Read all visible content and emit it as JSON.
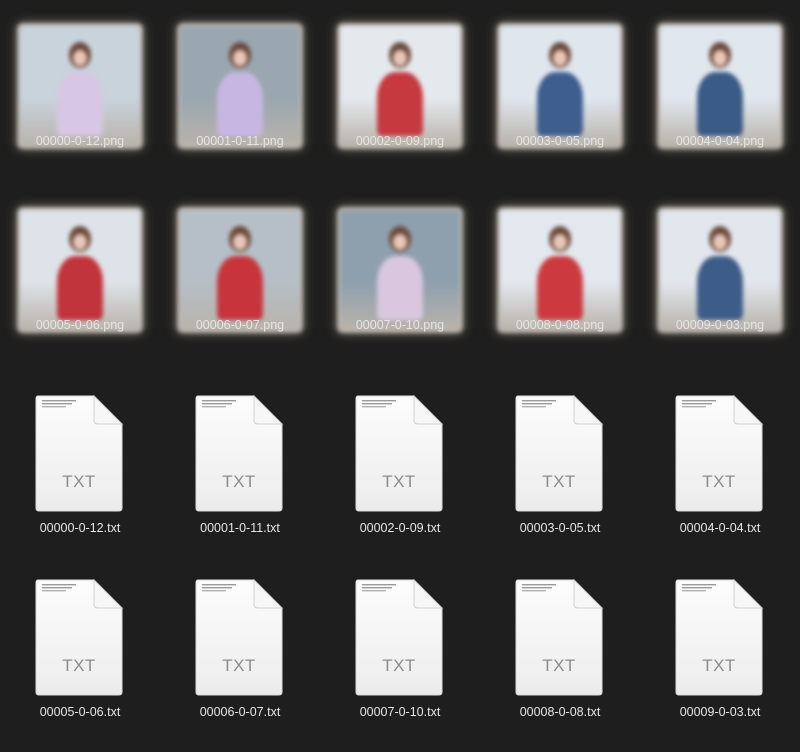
{
  "window": {
    "background": "#1e1e1e"
  },
  "files": {
    "png_row1": [
      {
        "name": "00000-0-12.png",
        "bg": "#c8d3dc",
        "outfit": "#d7c6e4"
      },
      {
        "name": "00001-0-11.png",
        "bg": "#9aa7b0",
        "outfit": "#c7b6e2"
      },
      {
        "name": "00002-0-09.png",
        "bg": "#e4e9ee",
        "outfit": "#c63a3f"
      },
      {
        "name": "00003-0-05.png",
        "bg": "#dfe6ee",
        "outfit": "#3d5e8f"
      },
      {
        "name": "00004-0-04.png",
        "bg": "#e1e7ef",
        "outfit": "#3a5b86"
      }
    ],
    "png_row2": [
      {
        "name": "00005-0-06.png",
        "bg": "#dde3e8",
        "outfit": "#c2343b"
      },
      {
        "name": "00006-0-07.png",
        "bg": "#b6bfc7",
        "outfit": "#c7343c"
      },
      {
        "name": "00007-0-10.png",
        "bg": "#8ea0ad",
        "outfit": "#d8c7df"
      },
      {
        "name": "00008-0-08.png",
        "bg": "#e3e8ef",
        "outfit": "#cc3a3f"
      },
      {
        "name": "00009-0-03.png",
        "bg": "#e2e7ee",
        "outfit": "#3d5c88"
      }
    ],
    "txt_row1": [
      {
        "name": "00000-0-12.txt",
        "kind": "TXT"
      },
      {
        "name": "00001-0-11.txt",
        "kind": "TXT"
      },
      {
        "name": "00002-0-09.txt",
        "kind": "TXT"
      },
      {
        "name": "00003-0-05.txt",
        "kind": "TXT"
      },
      {
        "name": "00004-0-04.txt",
        "kind": "TXT"
      }
    ],
    "txt_row2": [
      {
        "name": "00005-0-06.txt",
        "kind": "TXT"
      },
      {
        "name": "00006-0-07.txt",
        "kind": "TXT"
      },
      {
        "name": "00007-0-10.txt",
        "kind": "TXT"
      },
      {
        "name": "00008-0-08.txt",
        "kind": "TXT"
      },
      {
        "name": "00009-0-03.txt",
        "kind": "TXT"
      }
    ]
  },
  "icons": {
    "png": "image-thumbnail-icon",
    "txt": "text-document-icon"
  }
}
